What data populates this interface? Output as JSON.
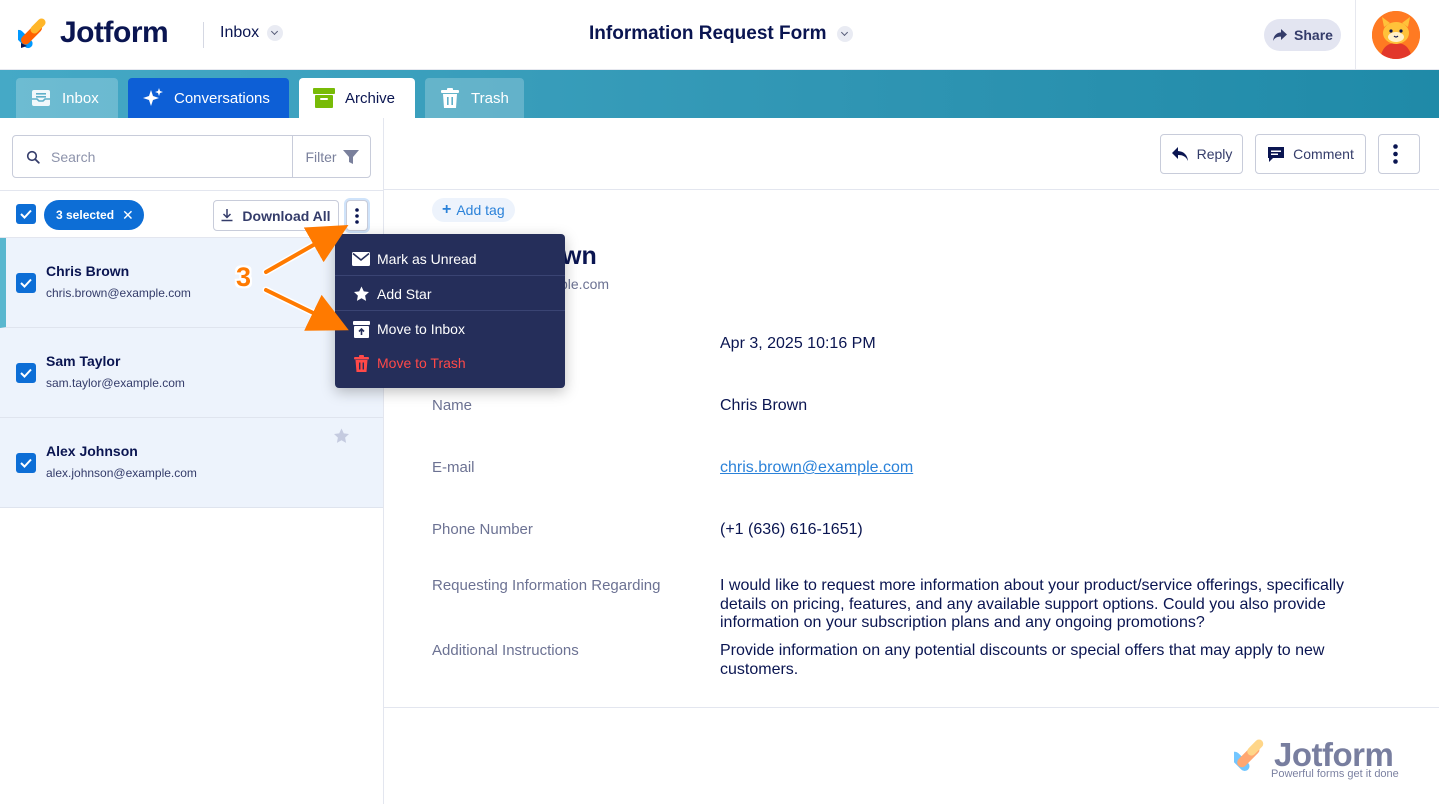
{
  "header": {
    "brand": "Jotform",
    "inbox_dropdown": "Inbox",
    "form_title": "Information Request Form",
    "share_label": "Share"
  },
  "tabs": [
    {
      "label": "Inbox"
    },
    {
      "label": "Conversations"
    },
    {
      "label": "Archive"
    },
    {
      "label": "Trash"
    }
  ],
  "search": {
    "placeholder": "Search",
    "value": "",
    "filter_label": "Filter"
  },
  "toolbar": {
    "selected_label": "3 selected",
    "download_all_label": "Download All"
  },
  "submissions": [
    {
      "name": "Chris Brown",
      "email": "chris.brown@example.com",
      "checked": true,
      "active": true
    },
    {
      "name": "Sam Taylor",
      "email": "sam.taylor@example.com",
      "checked": true,
      "active": false
    },
    {
      "name": "Alex Johnson",
      "email": "alex.johnson@example.com",
      "checked": true,
      "active": false
    }
  ],
  "context_menu": {
    "items": [
      {
        "label": "Mark as Unread",
        "icon": "envelope-icon"
      },
      {
        "label": "Add Star",
        "icon": "star-icon"
      },
      {
        "label": "Move to Inbox",
        "icon": "inbox-move-icon"
      },
      {
        "label": "Move to Trash",
        "icon": "trash-icon"
      }
    ]
  },
  "annotation": {
    "step_number": "3",
    "color": "#ff7a00"
  },
  "detail": {
    "reply_label": "Reply",
    "comment_label": "Comment",
    "add_tag_label": "Add tag",
    "visible_name_fragment": "wn",
    "visible_email_fragment": "ple.com",
    "date_value": "Apr 3, 2025 10:16 PM",
    "fields": [
      {
        "label": "Name",
        "value": "Chris Brown"
      },
      {
        "label": "E-mail",
        "value": "chris.brown@example.com"
      },
      {
        "label": "Phone Number",
        "value": "(+1 (636) 616-1651)"
      },
      {
        "label": "Requesting Information Regarding",
        "value": "I would like to request more information about your product/service offerings, specifically details on pricing, features, and any available support options. Could you also provide information on your subscription plans and any ongoing promotions?"
      },
      {
        "label": "Additional Instructions",
        "value": "Provide information on any potential discounts or special offers that may apply to new customers."
      }
    ]
  },
  "watermark": {
    "brand": "Jotform",
    "tagline": "Powerful forms get it done"
  },
  "colors": {
    "accent": "#0d6ed6",
    "brand_dark": "#0a1551",
    "menu_bg": "#252e5a",
    "danger": "#ff4948",
    "tabbar": "#2f95b3"
  }
}
